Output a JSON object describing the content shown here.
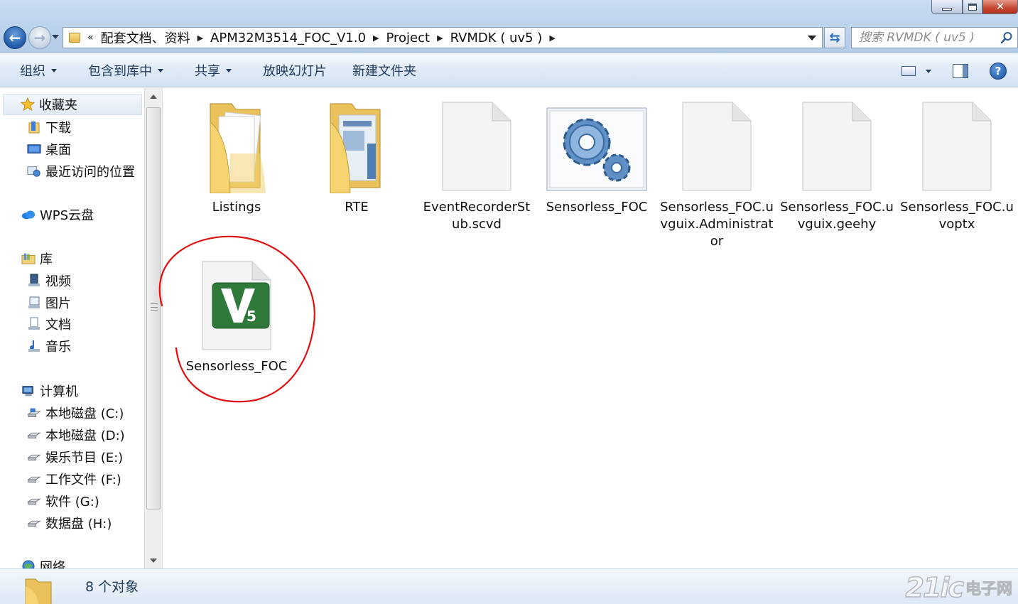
{
  "window": {
    "controls": {
      "minimize": "minimize",
      "maximize": "maximize",
      "close": "close"
    }
  },
  "address": {
    "segments": [
      "配套文档、资料",
      "APM32M3514_FOC_V1.0",
      "Project",
      "RVMDK ( uv5 )"
    ],
    "overflow": "«"
  },
  "search": {
    "placeholder": "搜索 RVMDK ( uv5 )"
  },
  "toolbar": {
    "organize": "组织",
    "include_in_library": "包含到库中",
    "share": "共享",
    "slideshow": "放映幻灯片",
    "new_folder": "新建文件夹"
  },
  "nav": {
    "favorites": "收藏夹",
    "downloads": "下载",
    "desktop": "桌面",
    "recent": "最近访问的位置",
    "wps": "WPS云盘",
    "libraries": "库",
    "videos": "视频",
    "pictures": "图片",
    "documents": "文档",
    "music": "音乐",
    "computer": "计算机",
    "drive_c": "本地磁盘 (C:)",
    "drive_d": "本地磁盘 (D:)",
    "drive_e": "娱乐节目 (E:)",
    "drive_f": "工作文件 (F:)",
    "drive_g": "软件 (G:)",
    "drive_h": "数据盘 (H:)",
    "network": "网络"
  },
  "files": [
    {
      "name": "Listings",
      "icon": "folder-icon"
    },
    {
      "name": "RTE",
      "icon": "folder-icon"
    },
    {
      "name": "EventRecorderStub.scvd",
      "icon": "blank-file-icon"
    },
    {
      "name": "Sensorless_FOC",
      "icon": "gear-settings-icon"
    },
    {
      "name": "Sensorless_FOC.uvguix.Administrator",
      "icon": "blank-file-icon"
    },
    {
      "name": "Sensorless_FOC.uvguix.geehy",
      "icon": "blank-file-icon"
    },
    {
      "name": "Sensorless_FOC.uvoptx",
      "icon": "blank-file-icon"
    },
    {
      "name": "Sensorless_FOC",
      "icon": "keil-uvision-icon"
    }
  ],
  "status": {
    "count": "8 个对象"
  },
  "watermark": {
    "text": "21ic",
    "subtext": "电子网"
  },
  "colors": {
    "annotation": "#e01010",
    "toolbar_text": "#1e395b"
  }
}
